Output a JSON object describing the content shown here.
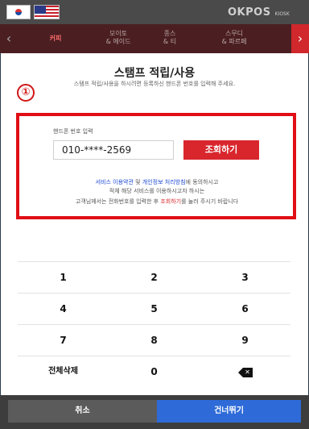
{
  "header": {
    "brand": "OKPOS",
    "brand_suffix": "KIOSK",
    "languages": [
      "kr-flag-icon",
      "us-flag-icon"
    ]
  },
  "category_tabs": [
    {
      "line1": "커피",
      "line2": "",
      "active": true
    },
    {
      "line1": "모이토",
      "line2": "& 에이드",
      "active": false
    },
    {
      "line1": "종스",
      "line2": "& 티",
      "active": false
    },
    {
      "line1": "스무디",
      "line2": "& 파르페",
      "active": false
    }
  ],
  "page": {
    "title": "스탬프 적립/사용",
    "subtitle": "스탬프 적립/사용을 하시려면 등록하신 핸드폰 번호를 입력해 주세요.",
    "marker": "①"
  },
  "form": {
    "phone_label": "핸드폰 번호 입력",
    "phone_value": "010-****-2569",
    "lookup_button": "조회하기",
    "consent_link1": "서비스 이용약관",
    "consent_and": " 및 ",
    "consent_link2": "개인정보 처리방침",
    "consent_rest1": "에 동의하시고",
    "consent_line2": "적체 해당 서비스를 이용하시고자 하시는",
    "consent_line3_pre": "고객님께서는 전화번호를 입력한 후 ",
    "consent_line3_link": "조회하기",
    "consent_line3_post": "를 눌러 주시기 바랍니다"
  },
  "keypad": {
    "keys": [
      "1",
      "2",
      "3",
      "4",
      "5",
      "6",
      "7",
      "8",
      "9",
      "전체삭제",
      "0",
      "backspace"
    ]
  },
  "footer": {
    "cancel": "취소",
    "skip": "건너뛰기"
  },
  "colors": {
    "accent_red": "#d8262c",
    "highlight_red": "#e10e16",
    "skip_blue": "#2e6bd8",
    "tab_bar": "#4b1f22"
  }
}
